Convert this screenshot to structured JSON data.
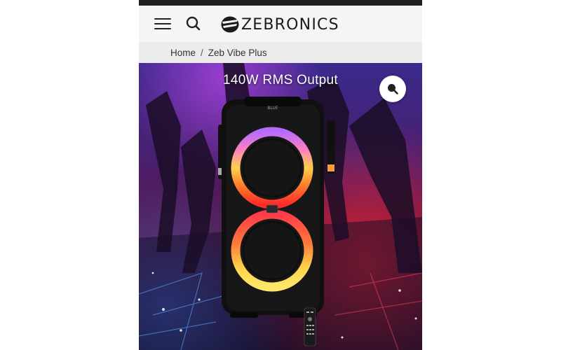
{
  "header": {
    "brand": "ZEBRONICS",
    "menu_icon": "hamburger-menu-icon",
    "search_icon": "search-icon"
  },
  "breadcrumb": {
    "home": "Home",
    "separator": "/",
    "current": "Zeb Vibe Plus"
  },
  "hero": {
    "caption": "140W RMS Output",
    "speaker_badge": "BLUE",
    "zoom_icon": "zoom-search-icon"
  },
  "colors": {
    "status_strip": "#1f1f1f",
    "header_bg": "#f5f5f5",
    "breadcrumb_bg": "#ececec",
    "text_dark": "#222222"
  }
}
